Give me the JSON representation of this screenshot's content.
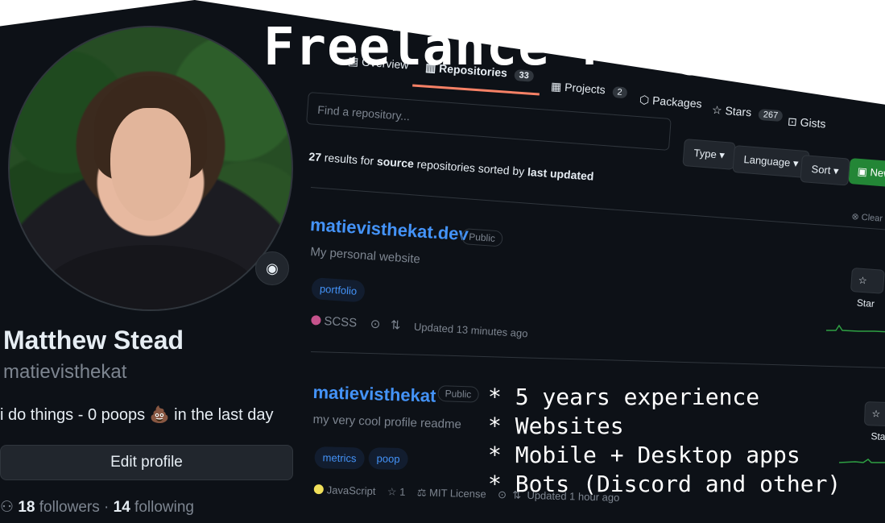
{
  "headline": "Freelance Programmer",
  "profile": {
    "name": "Matthew Stead",
    "login": "matievisthekat",
    "bio": "i do things - 0 poops 💩 in the last day",
    "edit_button": "Edit profile",
    "followers_count": "18",
    "followers_label": "followers",
    "following_count": "14",
    "following_label": "following",
    "separator": "·"
  },
  "tabs": [
    {
      "label": "Overview",
      "count": ""
    },
    {
      "label": "Repositories",
      "count": "33"
    },
    {
      "label": "Projects",
      "count": "2"
    },
    {
      "label": "Packages",
      "count": ""
    },
    {
      "label": "Stars",
      "count": "267"
    },
    {
      "label": "Gists",
      "count": ""
    }
  ],
  "search": {
    "placeholder": "Find a repository..."
  },
  "filters": {
    "type": "Type ▾",
    "language": "Language ▾",
    "sort": "Sort ▾",
    "new": "New"
  },
  "results": {
    "count": "27",
    "text1": " results for ",
    "kind": "source",
    "text2": " repositories sorted by ",
    "sort": "last updated"
  },
  "clear_filter": "Clear",
  "repos": [
    {
      "name": "matievisthekat.dev",
      "visibility": "Public",
      "description": "My personal website",
      "topics": [
        "portfolio"
      ],
      "language": "SCSS",
      "language_color": "#c6538c",
      "updated": "Updated 13 minutes ago",
      "star_label": "Star"
    },
    {
      "name": "matievisthekat",
      "visibility": "Public",
      "description": "my very cool profile readme",
      "topics": [
        "metrics",
        "poop"
      ],
      "language": "JavaScript",
      "language_color": "#f1e05a",
      "stars": "1",
      "license": "MIT License",
      "updated": "Updated 1 hour ago",
      "star_label": "Star"
    }
  ],
  "bullets": [
    "* 5 years experience",
    "* Websites",
    "* Mobile + Desktop apps",
    "* Bots (Discord and other)"
  ],
  "colors": {
    "accent": "#4493f8",
    "tab_underline": "#f78166",
    "new_button": "#238636"
  }
}
